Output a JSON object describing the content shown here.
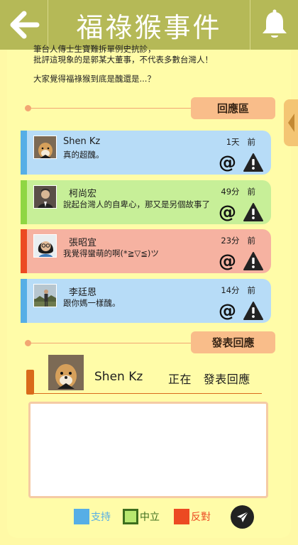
{
  "header": {
    "title": "福祿猴事件",
    "back_icon": "arrow-left-icon",
    "bell_icon": "bell-icon"
  },
  "article": {
    "lines": [
      "筆台人傳士生寶難拆單例史抗診，",
      "批評這現象的是郭某大董事，不代表多數台灣人！",
      "大家覺得福祿猴到底是醜還是...？"
    ]
  },
  "comments_section": {
    "label": "回應區"
  },
  "comments": [
    {
      "name": "Shen Kz",
      "text": "真的超醜。",
      "time_value": "1天",
      "time_suffix": "前",
      "color": "#b7dcf7",
      "bar_color": "#56aee6",
      "stance": "支持"
    },
    {
      "name": "柯尚宏",
      "text": "說起台灣人的自卑心，那又是另個故事了",
      "time_value": "49分",
      "time_suffix": "前",
      "color": "#c7ef98",
      "bar_color": "#8fd644",
      "stance": "中立"
    },
    {
      "name": "張昭宜",
      "text": "我覺得蠻萌的啊(*≧▽≦)ツ",
      "time_value": "23分",
      "time_suffix": "前",
      "color": "#f6b2a1",
      "bar_color": "#ec4a22",
      "stance": "反對"
    },
    {
      "name": "李廷恩",
      "text": "跟你媽一樣醜。",
      "time_value": "14分",
      "time_suffix": "前",
      "color": "#b7dcf7",
      "bar_color": "#56aee6",
      "stance": "支持"
    }
  ],
  "post_section": {
    "label": "發表回應",
    "user_name": "Shen Kz",
    "status_prefix": "正在",
    "status_action": "發表回應",
    "textarea_placeholder": ""
  },
  "legend": [
    {
      "label": "支持",
      "color": "#56aee6"
    },
    {
      "label": "中立",
      "color": "#7ccf3a"
    },
    {
      "label": "反對",
      "color": "#ec4a22"
    }
  ],
  "send_icon": "paper-plane-icon",
  "colors": {
    "header": "#b5b957",
    "background": "#fff9a6",
    "section_accent": "#f9bd8a"
  }
}
